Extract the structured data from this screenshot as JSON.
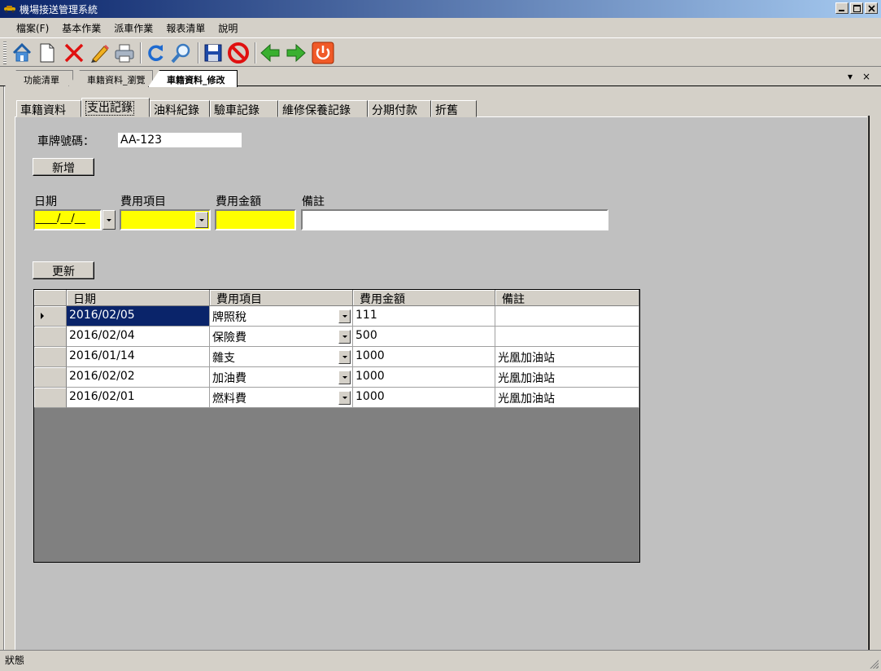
{
  "window": {
    "title": "機場接送管理系統"
  },
  "menu": [
    "檔案(F)",
    "基本作業",
    "派車作業",
    "報表清單",
    "說明"
  ],
  "toolbar": [
    {
      "name": "home-icon"
    },
    {
      "name": "new-icon"
    },
    {
      "name": "delete-icon"
    },
    {
      "name": "edit-icon"
    },
    {
      "name": "print-icon"
    },
    {
      "name": "refresh-icon"
    },
    {
      "name": "search-icon"
    },
    {
      "name": "save-icon"
    },
    {
      "name": "cancel-icon"
    },
    {
      "name": "back-icon"
    },
    {
      "name": "forward-icon"
    },
    {
      "name": "power-icon"
    }
  ],
  "doc_tabs": [
    "功能清單",
    "車籍資料_瀏覽",
    "車籍資料_修改"
  ],
  "doc_controls": {
    "dropdown": "▾",
    "close": "×"
  },
  "sub_tabs": [
    "車籍資料",
    "支出記錄",
    "油料紀錄",
    "驗車記錄",
    "維修保養記錄",
    "分期付款",
    "折舊"
  ],
  "form": {
    "plate_label": "車牌號碼：",
    "plate_value": "AA-123",
    "add_button": "新增",
    "update_button": "更新",
    "labels": {
      "date": "日期",
      "item": "費用項目",
      "amount": "費用金額",
      "note": "備註"
    },
    "date_mask": "____/__/__"
  },
  "grid": {
    "columns": [
      "日期",
      "費用項目",
      "費用金額",
      "備註"
    ],
    "rows": [
      {
        "date": "2016/02/05",
        "item": "牌照稅",
        "amount": "111",
        "note": ""
      },
      {
        "date": "2016/02/04",
        "item": "保險費",
        "amount": "500",
        "note": ""
      },
      {
        "date": "2016/01/14",
        "item": "雜支",
        "amount": "1000",
        "note": "光凰加油站"
      },
      {
        "date": "2016/02/02",
        "item": "加油費",
        "amount": "1000",
        "note": "光凰加油站"
      },
      {
        "date": "2016/02/01",
        "item": "燃料費",
        "amount": "1000",
        "note": "光凰加油站"
      }
    ]
  },
  "status": {
    "text": "狀態"
  },
  "colors": {
    "title_blue": "#0a246a",
    "highlight_yellow": "#ffff00",
    "selection": "#0a246a"
  }
}
